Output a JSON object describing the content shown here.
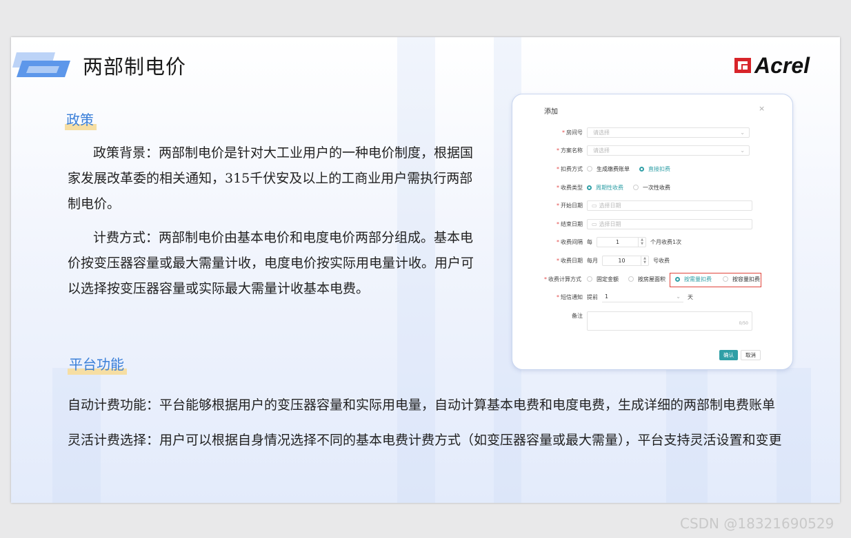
{
  "slide": {
    "title": "两部制电价",
    "logo_text": "Acrel",
    "section1": "政策",
    "policy_background": "政策背景：两部制电价是针对大工业用户的一种电价制度，根据国家发展改革委的相关通知，315千伏安及以上的工商业用户需执行两部制电价。",
    "billing_method": "计费方式：两部制电价由基本电价和电度电价两部分组成。基本电价按变压器容量或最大需量计收，电度电价按实际用电量计收。用户可以选择按变压器容量或实际最大需量计收基本电费。",
    "section2": "平台功能",
    "feature1": "自动计费功能：平台能够根据用户的变压器容量和实际用电量，自动计算基本电费和电度电费，生成详细的两部制电费账单",
    "feature2": "灵活计费选择：用户可以根据自身情况选择不同的基本电费计费方式（如变压器容量或最大需量），平台支持灵活设置和变更"
  },
  "dialog": {
    "title": "添加",
    "close": "×",
    "room_label": "房间号",
    "room_placeholder": "请选择",
    "plan_label": "方案名称",
    "plan_placeholder": "请选择",
    "deduct_label": "扣费方式",
    "deduct_opt1": "生成缴费账单",
    "deduct_opt2": "直接扣费",
    "fee_type_label": "收费类型",
    "fee_type_opt1": "周期性收费",
    "fee_type_opt2": "一次性收费",
    "start_label": "开始日期",
    "start_placeholder": "选择日期",
    "end_label": "结束日期",
    "end_placeholder": "选择日期",
    "interval_label": "收费间隔",
    "interval_prefix": "每",
    "interval_value": "1",
    "interval_suffix": "个月收费1次",
    "date_label": "收费日期",
    "date_prefix": "每月",
    "date_value": "10",
    "date_suffix": "号收费",
    "calc_label": "收费计算方式",
    "calc_opt1": "固定金额",
    "calc_opt2": "按房屋面积",
    "calc_opt3": "按需量扣费",
    "calc_opt4": "按容量扣费",
    "sms_label": "短信通知",
    "sms_prefix": "提前",
    "sms_value": "1",
    "sms_suffix": "天",
    "remark_label": "备注",
    "remark_count": "0/50",
    "confirm": "确认",
    "cancel": "取消"
  },
  "watermark": "CSDN @18321690529",
  "colors": {
    "accent": "#2f9fa6",
    "highlight": "#e0433a",
    "heading": "#3a7fd8"
  }
}
